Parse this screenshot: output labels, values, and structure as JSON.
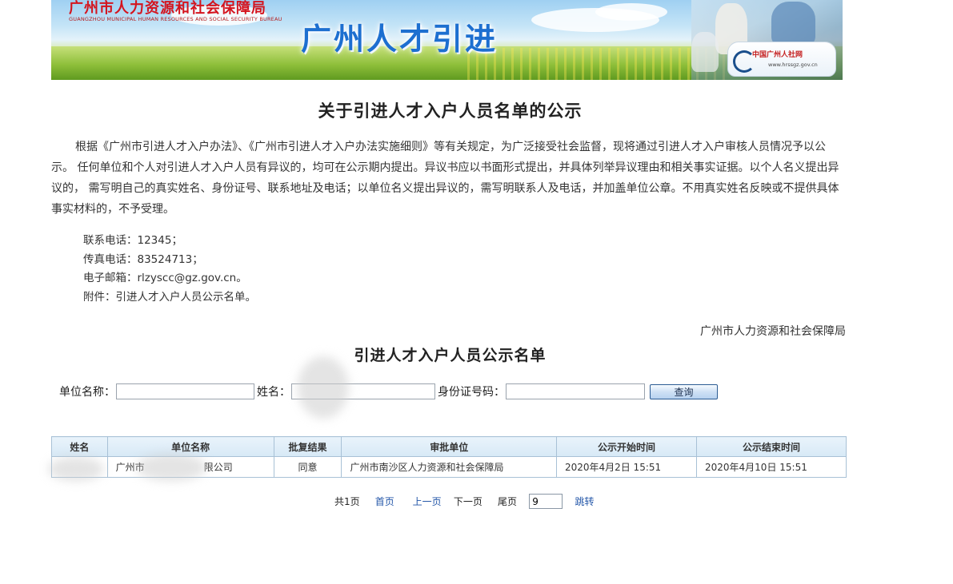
{
  "banner": {
    "org_name": "广州市人力资源和社会保障局",
    "org_name_en": "GUANGZHOU MUNICIPAL HUMAN RESOURCES AND SOCIAL SECURITY BUREAU",
    "headline": "广州人才引进",
    "portal_name": "中国广州人社网",
    "portal_url": "www.hrssgz.gov.cn"
  },
  "notice": {
    "title": "关于引进人才入户人员名单的公示",
    "body": "根据《广州市引进人才入户办法》、《广州市引进人才入户办法实施细则》等有关规定，为广泛接受社会监督，现将通过引进人才入户审核人员情况予以公示。 任何单位和个人对引进人才入户人员有异议的，均可在公示期内提出。异议书应以书面形式提出，并具体列举异议理由和相关事实证据。以个人名义提出异议的， 需写明自己的真实姓名、身份证号、联系地址及电话；以单位名义提出异议的，需写明联系人及电话，并加盖单位公章。不用真实姓名反映或不提供具体事实材料的，不予受理。",
    "contacts": [
      "联系电话：12345；",
      "传真电话：83524713；",
      "电子邮箱：rlzyscc@gz.gov.cn。",
      "附件：引进人才入户人员公示名单。"
    ],
    "signature": "广州市人力资源和社会保障局"
  },
  "list_title": "引进人才入户人员公示名单",
  "search": {
    "unit_label": "单位名称：",
    "unit_value": "",
    "name_label": "姓名：",
    "name_value": "",
    "id_label": "身份证号码：",
    "id_value": "",
    "submit_label": "查询"
  },
  "table": {
    "headers": [
      "姓名",
      "单位名称",
      "批复结果",
      "审批单位",
      "公示开始时间",
      "公示结束时间"
    ],
    "rows": [
      [
        "",
        "广州市",
        "限公司",
        "同意",
        "广州市南沙区人力资源和社会保障局",
        "2020年4月2日 15:51",
        "2020年4月10日 15:51"
      ]
    ]
  },
  "pager": {
    "total": "共1页",
    "first": "首页",
    "prev": "上一页",
    "next": "下一页",
    "last": "尾页",
    "page_input": "9",
    "jump": "跳转"
  },
  "colors": {
    "headline": "#1d6fd0",
    "org_name": "#d4141e",
    "table_header_bg": "#d7e9f6",
    "table_border": "#a8c1d6",
    "link": "#2356a8"
  }
}
